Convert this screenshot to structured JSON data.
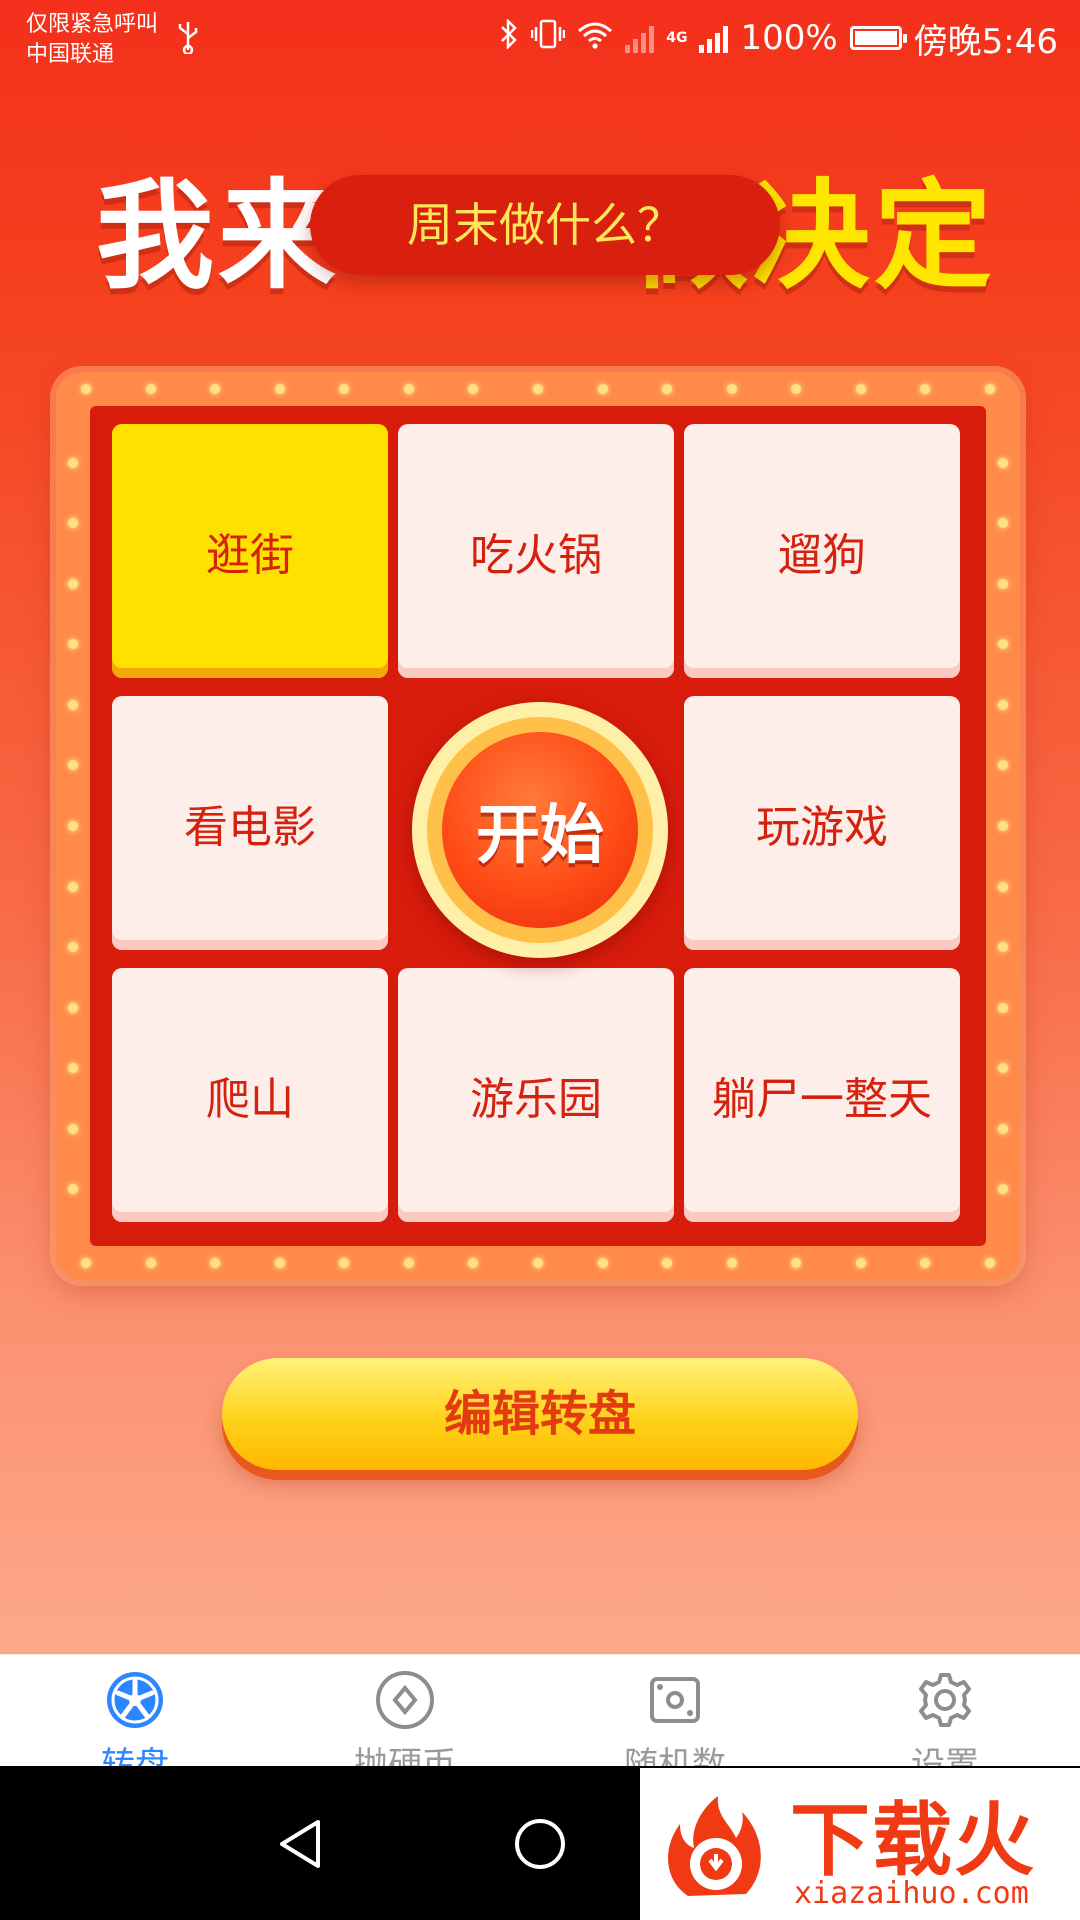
{
  "status_bar": {
    "carrier_line1": "仅限紧急呼叫",
    "carrier_line2": "中国联通",
    "network": "4G",
    "battery": "100%",
    "time": "傍晚5:46"
  },
  "header": {
    "title_left": "我来",
    "title_right": "做决定",
    "question": "周末做什么？"
  },
  "board": {
    "selected_index": 0,
    "cells": [
      "逛街",
      "吃火锅",
      "遛狗",
      "看电影",
      "玩游戏",
      "爬山",
      "游乐园",
      "躺尸一整天"
    ],
    "start_label": "开始"
  },
  "edit_button": {
    "label": "编辑转盘"
  },
  "bottom_nav": {
    "active": 0,
    "items": [
      {
        "label": "转盘",
        "icon": "wheel-icon"
      },
      {
        "label": "抛硬币",
        "icon": "coin-icon"
      },
      {
        "label": "随机数",
        "icon": "dice-icon"
      },
      {
        "label": "设置",
        "icon": "gear-icon"
      }
    ]
  },
  "colors": {
    "accent_blue": "#2c86ff",
    "board_red": "#d81c0c",
    "highlight_yellow": "#ffe100"
  },
  "watermark": {
    "brand": "下载火",
    "url": "xiazaihuo.com"
  }
}
